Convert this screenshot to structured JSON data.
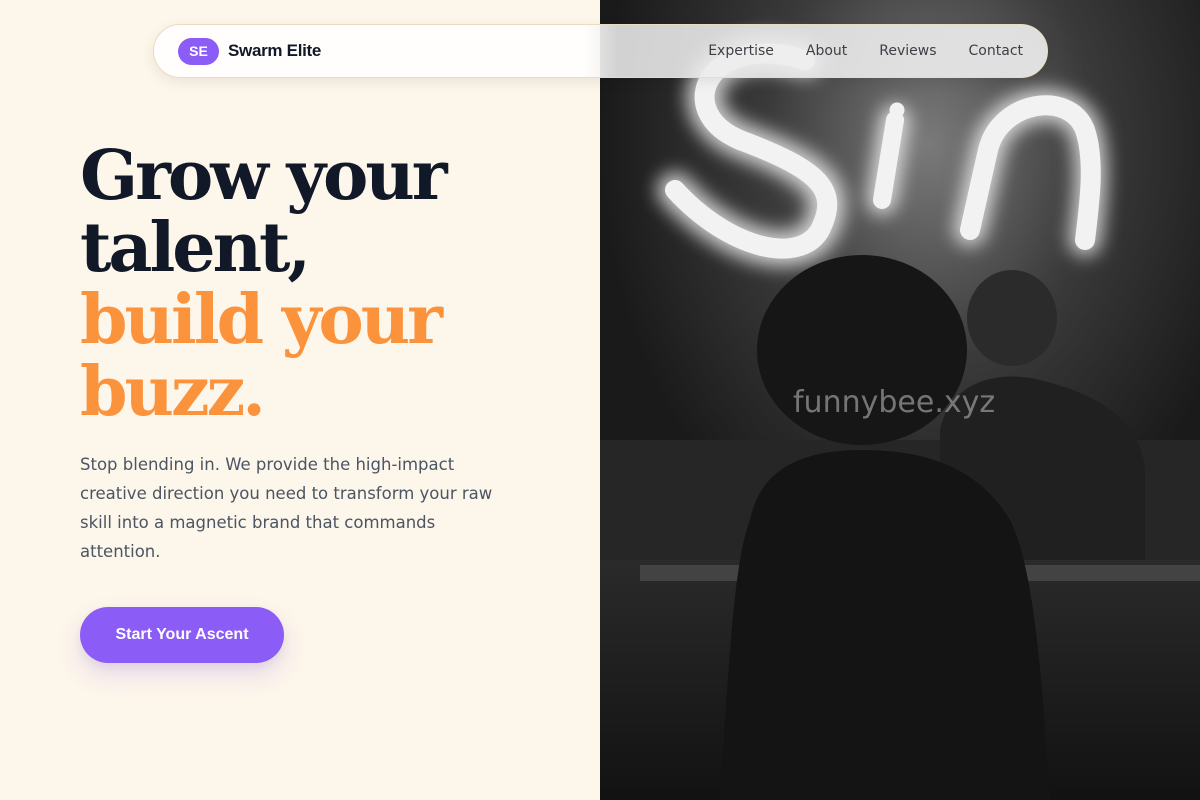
{
  "brand": {
    "badge": "SE",
    "name": "Swarm Elite"
  },
  "nav": {
    "items": [
      "Expertise",
      "About",
      "Reviews",
      "Contact"
    ]
  },
  "hero": {
    "line1": "Grow your",
    "line2": "talent,",
    "line3": "build your",
    "line4": "buzz.",
    "description": "Stop blending in. We provide the high-impact creative direction you need to transform your raw skill into a magnetic brand that commands attention.",
    "cta": "Start Your Ascent"
  },
  "image": {
    "neon_text": "Sin",
    "watermark": "funnybee.xyz"
  },
  "colors": {
    "accent_purple": "#8b5cf6",
    "accent_orange": "#fb923c",
    "background": "#fdf6ea",
    "heading": "#111827"
  }
}
